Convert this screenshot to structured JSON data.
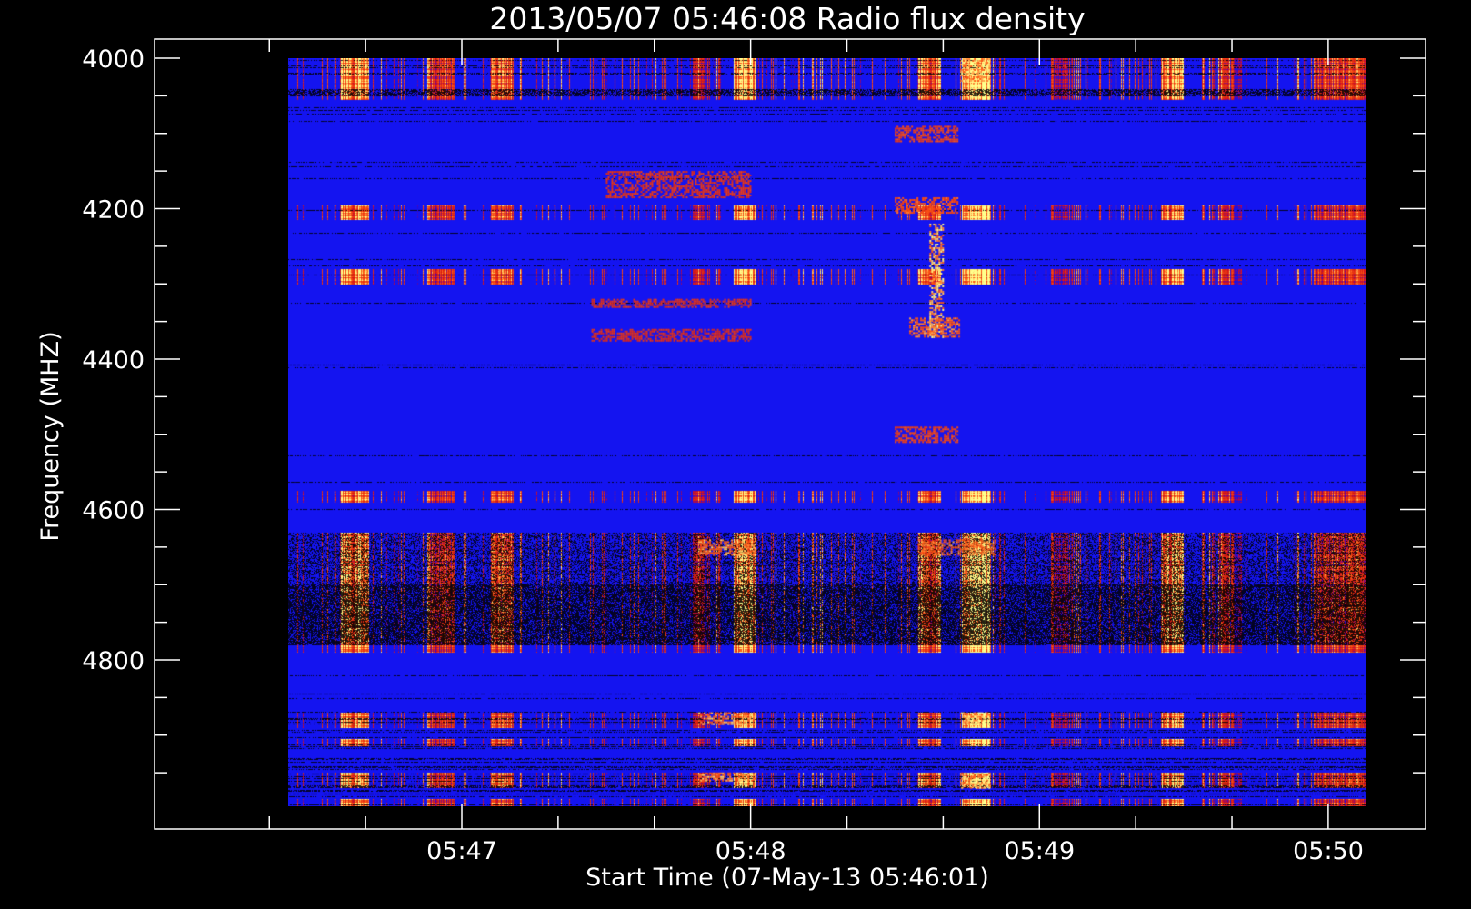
{
  "chart_data": {
    "type": "heatmap",
    "title": "2013/05/07 05:46:08 Radio flux density",
    "xlabel": "Start Time (07-May-13 05:46:01)",
    "ylabel": "Frequency (MHZ)",
    "y_ticks": [
      4000,
      4200,
      4400,
      4600,
      4800
    ],
    "y_minor_step": 50,
    "ylim": [
      4000,
      5000
    ],
    "x_ticks": [
      {
        "minute": 47,
        "label": "05:47"
      },
      {
        "minute": 48,
        "label": "05:48"
      },
      {
        "minute": 49,
        "label": "05:49"
      },
      {
        "minute": 50,
        "label": "05:50"
      }
    ],
    "x_minor_step": 0.3333,
    "xlim": [
      46.2,
      50.35
    ],
    "data_extent": {
      "x": [
        46.4,
        50.13
      ],
      "y": [
        4000,
        4995
      ]
    },
    "colors": {
      "low": "#000000",
      "mid": "#ff2000",
      "high": "#ffff80",
      "background": "#1010f0"
    },
    "bright_freq_bands": [
      [
        4000,
        4055
      ],
      [
        4195,
        4215
      ],
      [
        4280,
        4300
      ],
      [
        4575,
        4590
      ],
      [
        4630,
        4790
      ],
      [
        4870,
        4890
      ],
      [
        4905,
        4915
      ],
      [
        4950,
        4970
      ],
      [
        4985,
        4995
      ]
    ],
    "burst_columns": [
      {
        "t": [
          46.58,
          46.68
        ],
        "intensity": 0.9
      },
      {
        "t": [
          46.88,
          46.97
        ],
        "intensity": 0.7
      },
      {
        "t": [
          47.1,
          47.18
        ],
        "intensity": 0.75
      },
      {
        "t": [
          47.8,
          47.86
        ],
        "intensity": 0.6
      },
      {
        "t": [
          47.94,
          48.02
        ],
        "intensity": 0.95
      },
      {
        "t": [
          48.58,
          48.66
        ],
        "intensity": 0.8
      },
      {
        "t": [
          48.73,
          48.83
        ],
        "intensity": 1.0
      },
      {
        "t": [
          49.04,
          49.1
        ],
        "intensity": 0.6
      },
      {
        "t": [
          49.42,
          49.5
        ],
        "intensity": 0.85
      },
      {
        "t": [
          49.62,
          49.7
        ],
        "intensity": 0.6
      },
      {
        "t": [
          49.95,
          50.13
        ],
        "intensity": 0.7
      }
    ],
    "bursts": [
      {
        "t": [
          48.62,
          48.67
        ],
        "f": [
          4220,
          4370
        ],
        "intensity": 1.0
      },
      {
        "t": [
          48.5,
          48.72
        ],
        "f": [
          4090,
          4110
        ],
        "intensity": 0.6
      },
      {
        "t": [
          48.5,
          48.72
        ],
        "f": [
          4185,
          4205
        ],
        "intensity": 0.7
      },
      {
        "t": [
          48.55,
          48.72
        ],
        "f": [
          4345,
          4370
        ],
        "intensity": 0.8
      },
      {
        "t": [
          48.5,
          48.72
        ],
        "f": [
          4490,
          4510
        ],
        "intensity": 0.6
      },
      {
        "t": [
          47.5,
          48.0
        ],
        "f": [
          4150,
          4185
        ],
        "intensity": 0.45
      },
      {
        "t": [
          47.45,
          48.0
        ],
        "f": [
          4320,
          4330
        ],
        "intensity": 0.45
      },
      {
        "t": [
          47.45,
          48.0
        ],
        "f": [
          4360,
          4375
        ],
        "intensity": 0.4
      },
      {
        "t": [
          48.73,
          48.83
        ],
        "f": [
          4000,
          4030
        ],
        "intensity": 1.0
      },
      {
        "t": [
          48.73,
          48.83
        ],
        "f": [
          4870,
          4885
        ],
        "intensity": 1.0
      },
      {
        "t": [
          48.73,
          48.83
        ],
        "f": [
          4950,
          4970
        ],
        "intensity": 1.0
      },
      {
        "t": [
          47.82,
          48.02
        ],
        "f": [
          4870,
          4885
        ],
        "intensity": 0.9
      },
      {
        "t": [
          47.82,
          48.02
        ],
        "f": [
          4950,
          4962
        ],
        "intensity": 0.9
      },
      {
        "t": [
          47.82,
          48.02
        ],
        "f": [
          4640,
          4660
        ],
        "intensity": 0.9
      },
      {
        "t": [
          48.58,
          48.85
        ],
        "f": [
          4640,
          4660
        ],
        "intensity": 0.8
      }
    ]
  }
}
